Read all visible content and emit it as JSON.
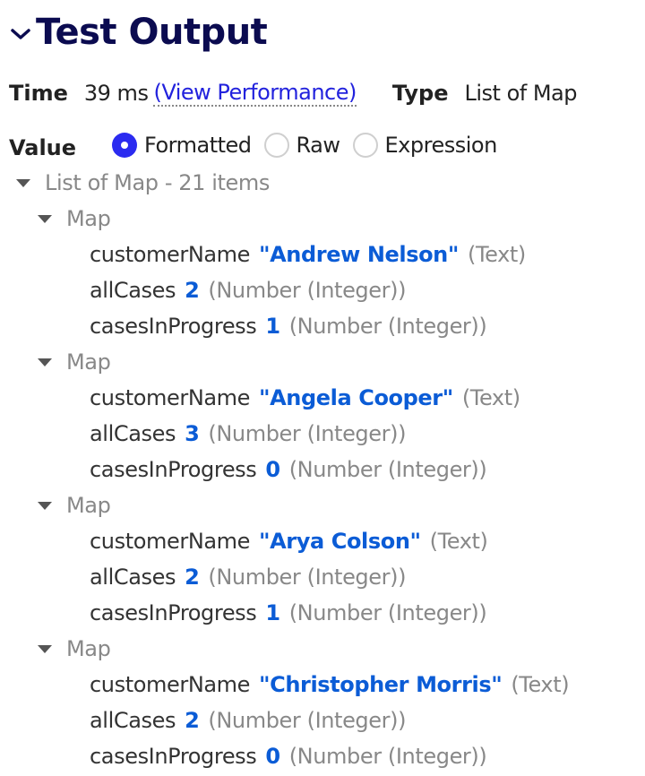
{
  "header": {
    "title": "Test Output",
    "collapse_icon": "chevron-down-icon"
  },
  "meta": {
    "time_label": "Time",
    "time_value": "39 ms",
    "performance_link": "(View Performance)",
    "type_label": "Type",
    "type_value": "List of Map"
  },
  "value_selector": {
    "label": "Value",
    "options": [
      {
        "label": "Formatted",
        "checked": true
      },
      {
        "label": "Raw",
        "checked": false
      },
      {
        "label": "Expression",
        "checked": false
      }
    ]
  },
  "tree": {
    "root_label": "List of Map - 21 items",
    "maps": [
      {
        "label": "Map",
        "fields": [
          {
            "key": "customerName",
            "value": "\"Andrew Nelson\"",
            "type": "(Text)"
          },
          {
            "key": "allCases",
            "value": "2",
            "type": "(Number (Integer))"
          },
          {
            "key": "casesInProgress",
            "value": "1",
            "type": "(Number (Integer))"
          }
        ]
      },
      {
        "label": "Map",
        "fields": [
          {
            "key": "customerName",
            "value": "\"Angela Cooper\"",
            "type": "(Text)"
          },
          {
            "key": "allCases",
            "value": "3",
            "type": "(Number (Integer))"
          },
          {
            "key": "casesInProgress",
            "value": "0",
            "type": "(Number (Integer))"
          }
        ]
      },
      {
        "label": "Map",
        "fields": [
          {
            "key": "customerName",
            "value": "\"Arya Colson\"",
            "type": "(Text)"
          },
          {
            "key": "allCases",
            "value": "2",
            "type": "(Number (Integer))"
          },
          {
            "key": "casesInProgress",
            "value": "1",
            "type": "(Number (Integer))"
          }
        ]
      },
      {
        "label": "Map",
        "fields": [
          {
            "key": "customerName",
            "value": "\"Christopher Morris\"",
            "type": "(Text)"
          },
          {
            "key": "allCases",
            "value": "2",
            "type": "(Number (Integer))"
          },
          {
            "key": "casesInProgress",
            "value": "0",
            "type": "(Number (Integer))"
          }
        ]
      }
    ]
  },
  "colors": {
    "title": "#0b0b50",
    "link": "#2222dd",
    "radio_checked": "#2b2bf0",
    "value_text": "#0b5cd6",
    "muted_text": "#888888"
  }
}
